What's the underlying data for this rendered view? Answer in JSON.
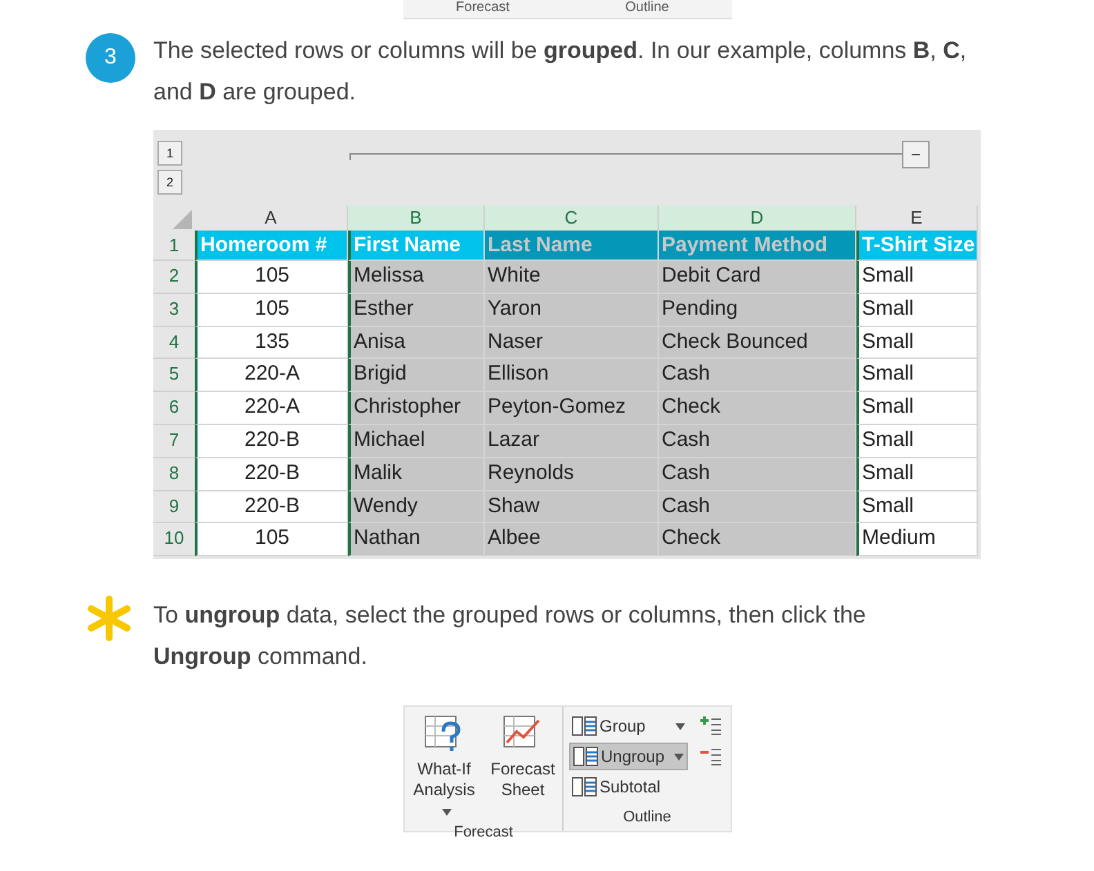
{
  "top_ribbon_strip": {
    "group_labels": [
      "Forecast",
      "Outline"
    ]
  },
  "step": {
    "number": "3",
    "text": "The selected rows or columns will be **grouped**. In our example, columns **B**, **C**, and **D** are grouped."
  },
  "spreadsheet": {
    "outline_levels": [
      "1",
      "2"
    ],
    "collapse_button": "−",
    "columns": [
      {
        "label": "A",
        "selected": false
      },
      {
        "label": "B",
        "selected": true
      },
      {
        "label": "C",
        "selected": true
      },
      {
        "label": "D",
        "selected": true
      },
      {
        "label": "E",
        "selected": false
      }
    ],
    "rows": [
      {
        "number": "1",
        "kind": "header",
        "cells": [
          "Homeroom #",
          "First Name",
          "Last Name",
          "Payment Method",
          "T-Shirt Size"
        ]
      },
      {
        "number": "2",
        "kind": "data",
        "cells": [
          "105",
          "Melissa",
          "White",
          "Debit Card",
          "Small"
        ]
      },
      {
        "number": "3",
        "kind": "data",
        "cells": [
          "105",
          "Esther",
          "Yaron",
          "Pending",
          "Small"
        ]
      },
      {
        "number": "4",
        "kind": "data",
        "cells": [
          "135",
          "Anisa",
          "Naser",
          "Check Bounced",
          "Small"
        ]
      },
      {
        "number": "5",
        "kind": "data",
        "cells": [
          "220-A",
          "Brigid",
          "Ellison",
          "Cash",
          "Small"
        ]
      },
      {
        "number": "6",
        "kind": "data",
        "cells": [
          "220-A",
          "Christopher",
          "Peyton-Gomez",
          "Check",
          "Small"
        ]
      },
      {
        "number": "7",
        "kind": "data",
        "cells": [
          "220-B",
          "Michael",
          "Lazar",
          "Cash",
          "Small"
        ]
      },
      {
        "number": "8",
        "kind": "data",
        "cells": [
          "220-B",
          "Malik",
          "Reynolds",
          "Cash",
          "Small"
        ]
      },
      {
        "number": "9",
        "kind": "data",
        "cells": [
          "220-B",
          "Wendy",
          "Shaw",
          "Cash",
          "Small"
        ]
      },
      {
        "number": "10",
        "kind": "data",
        "cells": [
          "105",
          "Nathan",
          "Albee",
          "Check",
          "Medium"
        ]
      }
    ]
  },
  "tip": {
    "text": "To **ungroup** data, select the grouped rows or columns, then click the **Ungroup** command."
  },
  "ribbon": {
    "forecast_group": {
      "label": "Forecast",
      "buttons": [
        {
          "label": "What-If Analysis",
          "dropdown": true
        },
        {
          "label": "Forecast Sheet",
          "dropdown": false
        }
      ]
    },
    "outline_group": {
      "label": "Outline",
      "commands": [
        {
          "label": "Group",
          "highlighted": false,
          "dropdown": true
        },
        {
          "label": "Ungroup",
          "highlighted": true,
          "dropdown": true
        },
        {
          "label": "Subtotal",
          "highlighted": false,
          "dropdown": false
        }
      ]
    }
  }
}
